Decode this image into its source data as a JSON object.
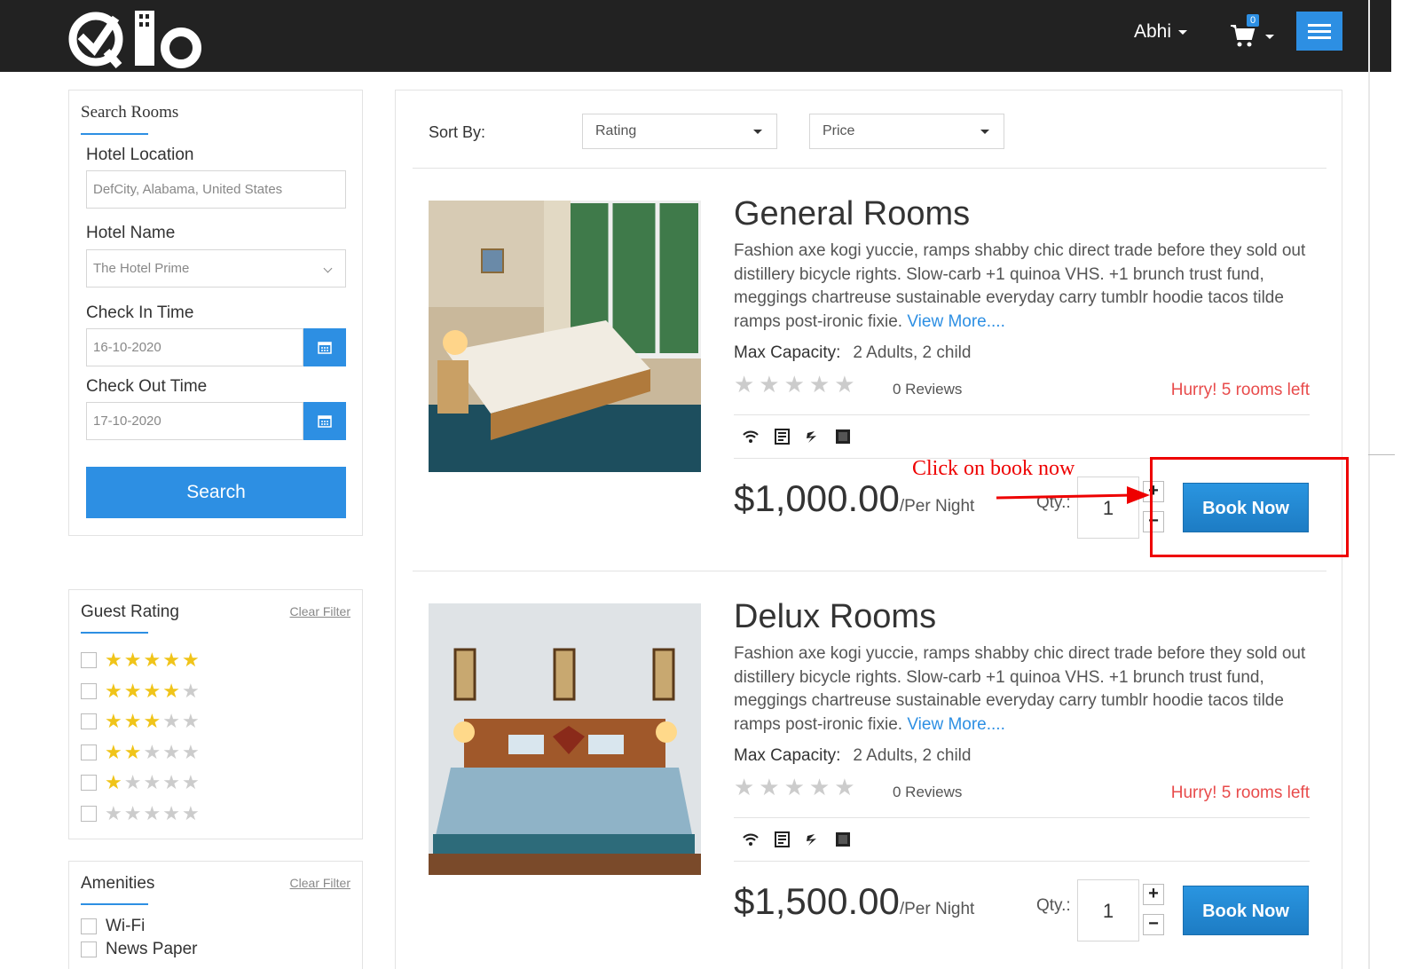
{
  "header": {
    "logo_text": "QLO",
    "user_name": "Abhi",
    "cart_count": "0"
  },
  "search_panel": {
    "title": "Search Rooms",
    "hotel_location_label": "Hotel Location",
    "hotel_location_value": "DefCity, Alabama, United States",
    "hotel_name_label": "Hotel Name",
    "hotel_name_value": "The Hotel Prime",
    "check_in_label": "Check In Time",
    "check_in_value": "16-10-2020",
    "check_out_label": "Check Out Time",
    "check_out_value": "17-10-2020",
    "search_button": "Search"
  },
  "guest_rating": {
    "title": "Guest Rating",
    "clear_filter": "Clear Filter",
    "options": [
      5,
      4,
      3,
      2,
      1,
      0
    ]
  },
  "amenities": {
    "title": "Amenities",
    "clear_filter": "Clear Filter",
    "items": [
      "Wi-Fi",
      "News Paper"
    ]
  },
  "sort": {
    "label": "Sort By:",
    "rating": "Rating",
    "price": "Price"
  },
  "rooms": [
    {
      "title": "General Rooms",
      "description": "Fashion axe kogi yuccie, ramps shabby chic direct trade before they sold out distillery bicycle rights. Slow-carb +1 quinoa VHS. +1 brunch trust fund, meggings chartreuse sustainable everyday carry tumblr hoodie tacos tilde ramps post-ironic fixie. ",
      "view_more": "View More....",
      "capacity_label": "Max Capacity:",
      "capacity_value": "2 Adults, 2 child",
      "reviews": "0 Reviews",
      "hurry": "Hurry! 5 rooms left",
      "price": "$1,000.00",
      "per_night": "/Per Night",
      "qty_label": "Qty.:",
      "qty_value": "1",
      "book_button": "Book Now"
    },
    {
      "title": "Delux Rooms",
      "description": "Fashion axe kogi yuccie, ramps shabby chic direct trade before they sold out distillery bicycle rights. Slow-carb +1 quinoa VHS. +1 brunch trust fund, meggings chartreuse sustainable everyday carry tumblr hoodie tacos tilde ramps post-ironic fixie. ",
      "view_more": "View More....",
      "capacity_label": "Max Capacity:",
      "capacity_value": "2 Adults, 2 child",
      "reviews": "0 Reviews",
      "hurry": "Hurry! 5 rooms left",
      "price": "$1,500.00",
      "per_night": "/Per Night",
      "qty_label": "Qty.:",
      "qty_value": "1",
      "book_button": "Book Now"
    }
  ],
  "annotation": {
    "text": "Click on book now",
    "color": "#e00000"
  },
  "colors": {
    "accent": "#2d8fe3",
    "topbar": "#222222",
    "hurry": "#e84b4b",
    "star_active": "#f0c419"
  }
}
